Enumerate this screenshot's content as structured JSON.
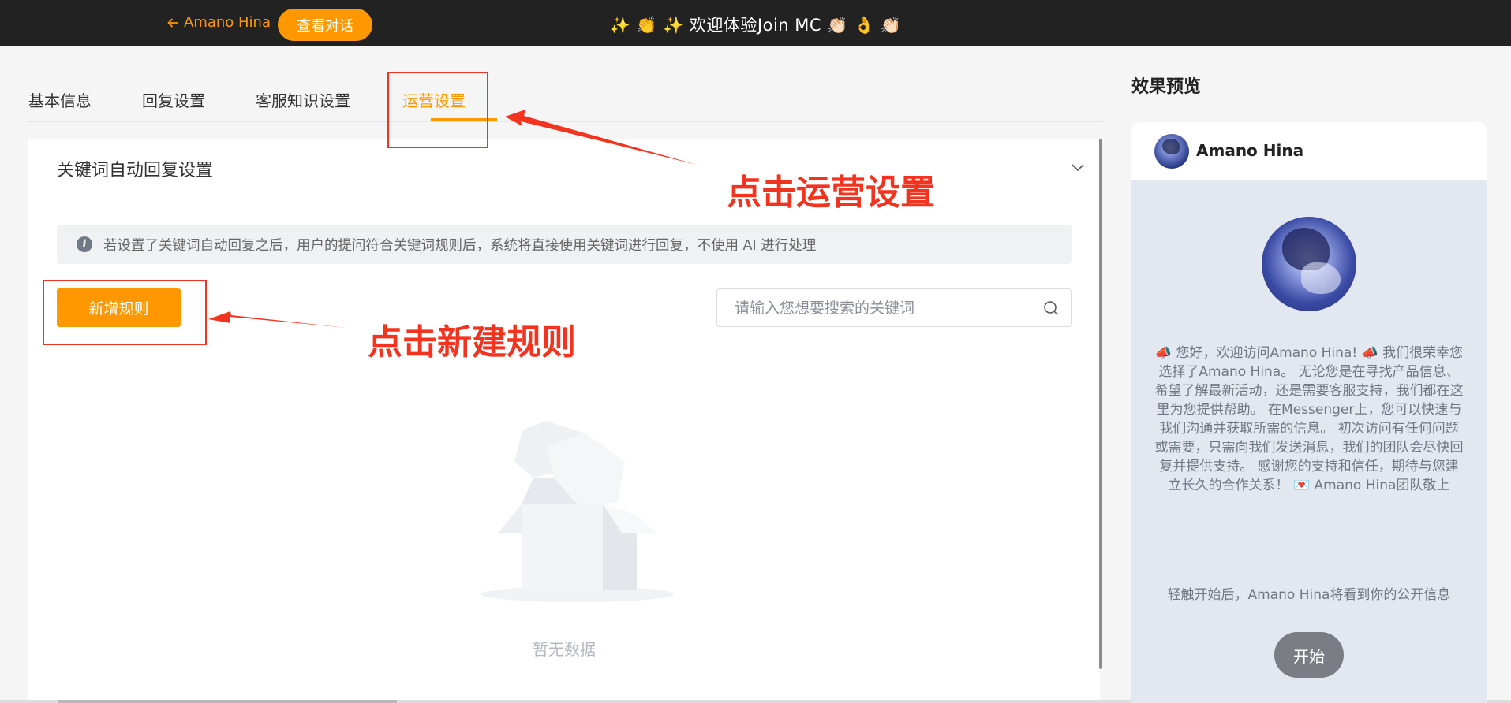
{
  "topbar": {
    "back_label": "Amano Hina",
    "view_chat_label": "查看对话",
    "title": "✨ 👏 ✨ 欢迎体验Join MC 👏🏻 👌 👏🏻"
  },
  "tabs": [
    {
      "label": "基本信息"
    },
    {
      "label": "回复设置"
    },
    {
      "label": "客服知识设置"
    },
    {
      "label": "运营设置"
    }
  ],
  "panel": {
    "title": "关键词自动回复设置",
    "notice": "若设置了关键词自动回复之后，用户的提问符合关键词规则后，系统将直接使用关键词进行回复，不使用 AI 进行处理",
    "add_rule_label": "新增规则",
    "search_placeholder": "请输入您想要搜索的关键词",
    "empty_text": "暂无数据"
  },
  "preview": {
    "section_title": "效果预览",
    "name": "Amano Hina",
    "welcome_message": "📣 您好，欢迎访问Amano Hina! 📣 我们很荣幸您选择了Amano Hina。 无论您是在寻找产品信息、希望了解最新活动，还是需要客服支持，我们都在这里为您提供帮助。 在Messenger上，您可以快速与我们沟通并获取所需的信息。 初次访问有任何问题或需要，只需向我们发送消息，我们的团队会尽快回复并提供支持。 感谢您的支持和信任，期待与您建立长久的合作关系！ 💌 Amano Hina团队敬上",
    "consent_text": "轻触开始后，Amano Hina将看到你的公开信息",
    "start_label": "开始"
  },
  "annotations": {
    "tab_hint": "点击运营设置",
    "rule_hint": "点击新建规则",
    "color": "#f2331f"
  },
  "colors": {
    "accent": "#ff9800",
    "topbar": "#222222"
  }
}
